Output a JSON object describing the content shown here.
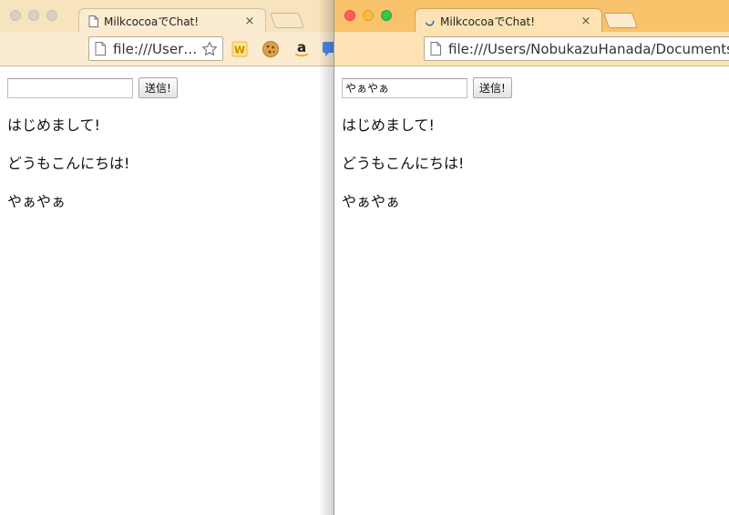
{
  "left": {
    "tab": {
      "title": "MilkcocoaでChat!",
      "close": "×"
    },
    "address": "file:///User…",
    "form": {
      "input_value": "",
      "send_label": "送信!"
    },
    "messages": [
      "はじめまして!",
      "どうもこんにちは!",
      "やぁやぁ"
    ],
    "extensions": [
      "w-extension-icon",
      "cookie-icon",
      "amazon-icon",
      "blue-extension-icon"
    ]
  },
  "right": {
    "tab": {
      "title": "MilkcocoaでChat!",
      "close": "×"
    },
    "address": "file:///Users/NobukazuHanada/Documents/gith",
    "form": {
      "input_value": "やぁやぁ",
      "send_label": "送信!"
    },
    "messages": [
      "はじめまして!",
      "どうもこんにちは!",
      "やぁやぁ"
    ]
  },
  "colors": {
    "left_chrome": "#f7e3bd",
    "right_chrome": "#f8c36b",
    "loading_spinner": "#2b6fd6"
  }
}
